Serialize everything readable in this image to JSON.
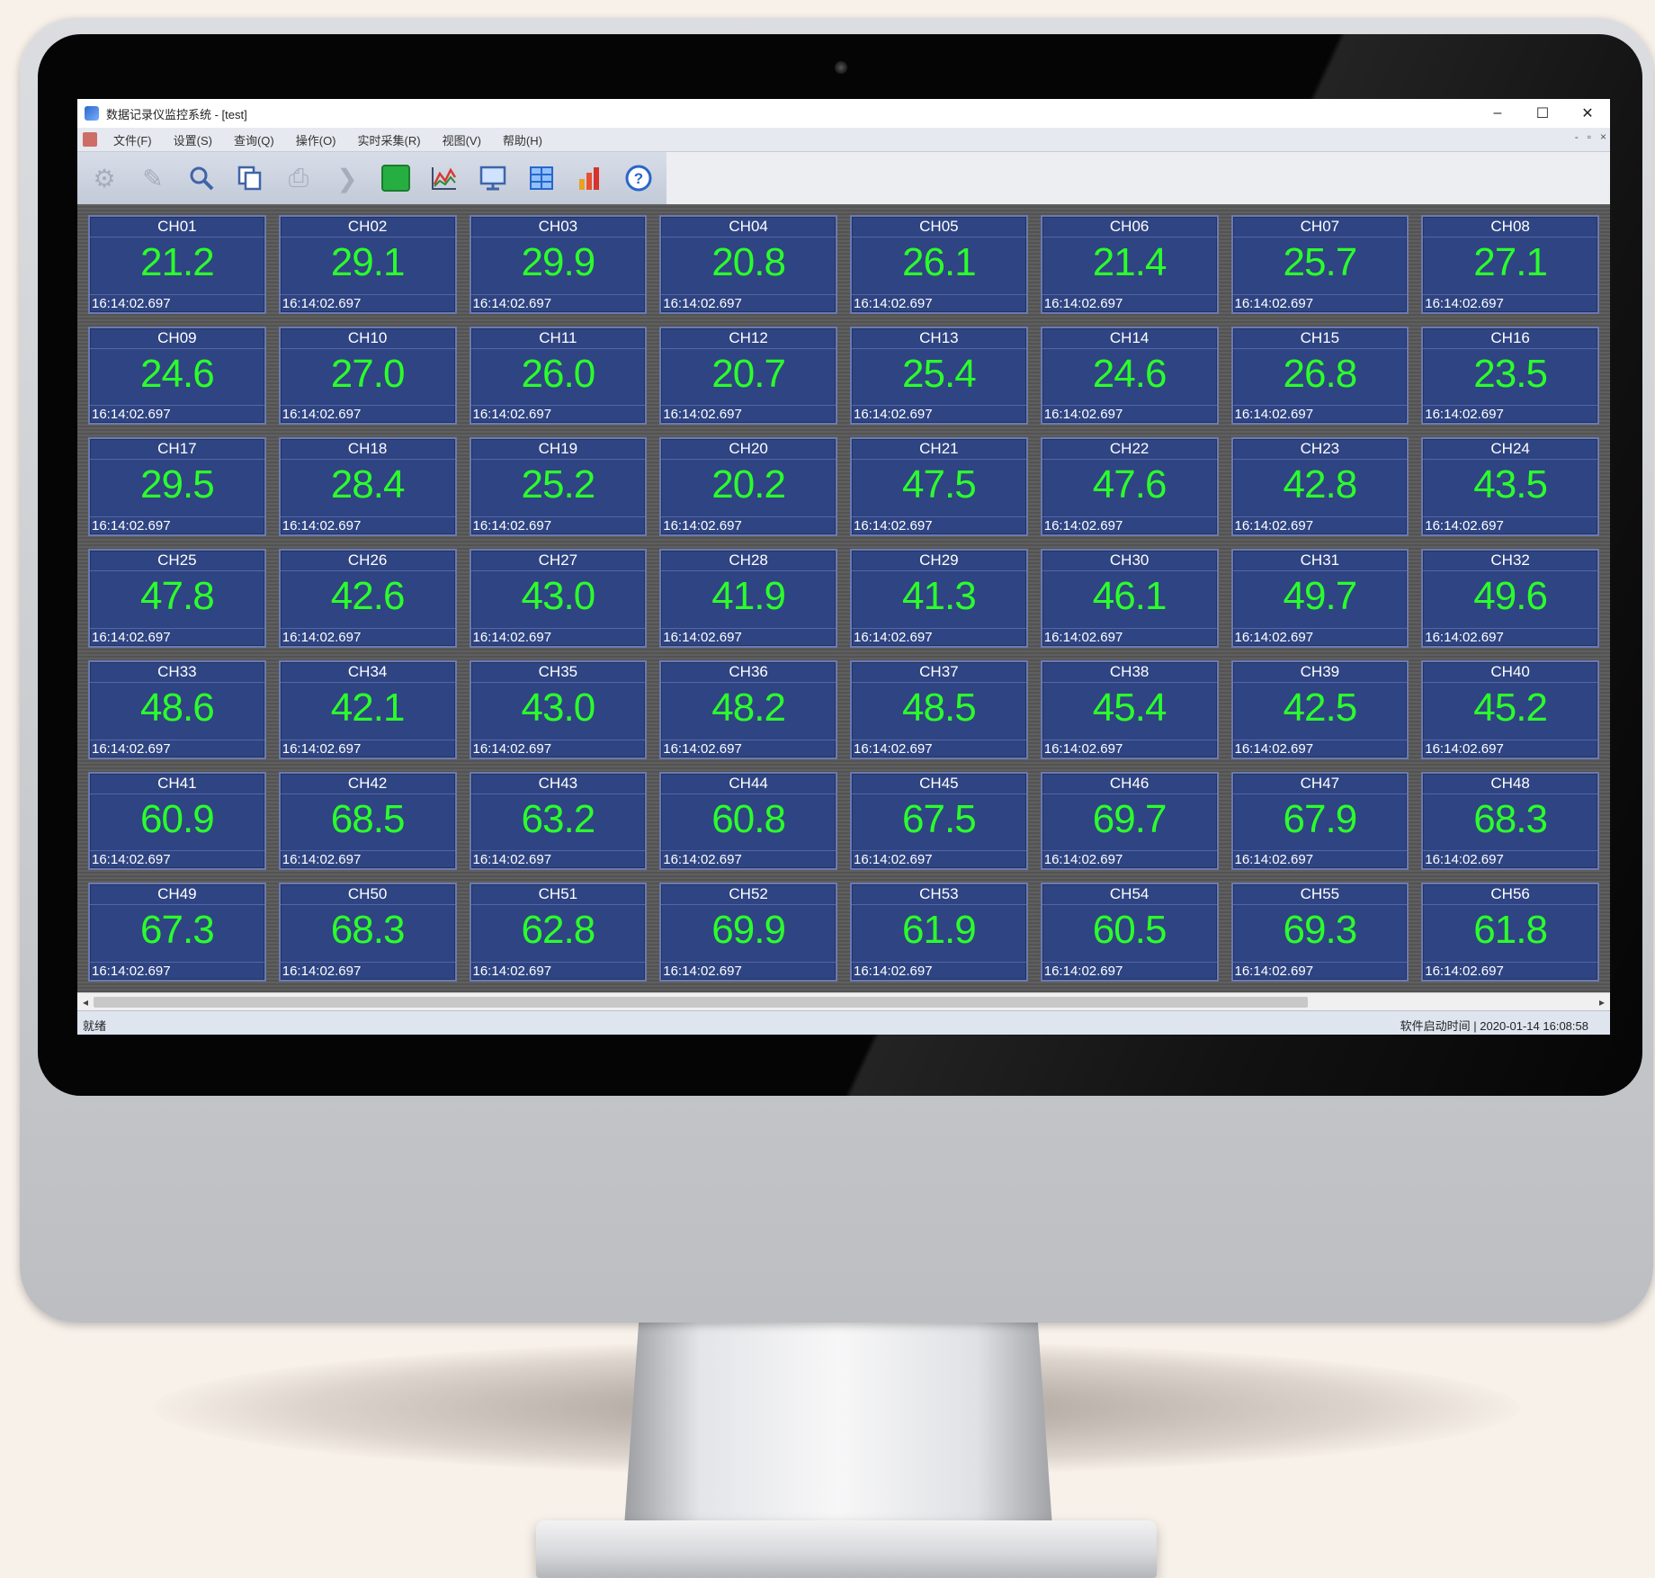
{
  "window": {
    "title": "数据记录仪监控系统 - [test]",
    "minimize": "–",
    "maximize": "☐",
    "close": "✕"
  },
  "menu": [
    "文件(F)",
    "设置(S)",
    "查询(Q)",
    "操作(O)",
    "实时采集(R)",
    "视图(V)",
    "帮助(H)"
  ],
  "mdi_controls": [
    "-",
    "▫",
    "×"
  ],
  "toolbar": [
    "connect-icon",
    "tools-icon",
    "search-icon",
    "copy-icon",
    "print-icon",
    "forward-icon",
    "green-block-icon",
    "curve-chart-icon",
    "monitor-icon",
    "table-icon",
    "bar-chart-icon",
    "help-icon"
  ],
  "channels": [
    {
      "name": "CH01",
      "value": "21.2"
    },
    {
      "name": "CH02",
      "value": "29.1"
    },
    {
      "name": "CH03",
      "value": "29.9"
    },
    {
      "name": "CH04",
      "value": "20.8"
    },
    {
      "name": "CH05",
      "value": "26.1"
    },
    {
      "name": "CH06",
      "value": "21.4"
    },
    {
      "name": "CH07",
      "value": "25.7"
    },
    {
      "name": "CH08",
      "value": "27.1"
    },
    {
      "name": "CH09",
      "value": "24.6"
    },
    {
      "name": "CH10",
      "value": "27.0"
    },
    {
      "name": "CH11",
      "value": "26.0"
    },
    {
      "name": "CH12",
      "value": "20.7"
    },
    {
      "name": "CH13",
      "value": "25.4"
    },
    {
      "name": "CH14",
      "value": "24.6"
    },
    {
      "name": "CH15",
      "value": "26.8"
    },
    {
      "name": "CH16",
      "value": "23.5"
    },
    {
      "name": "CH17",
      "value": "29.5"
    },
    {
      "name": "CH18",
      "value": "28.4"
    },
    {
      "name": "CH19",
      "value": "25.2"
    },
    {
      "name": "CH20",
      "value": "20.2"
    },
    {
      "name": "CH21",
      "value": "47.5"
    },
    {
      "name": "CH22",
      "value": "47.6"
    },
    {
      "name": "CH23",
      "value": "42.8"
    },
    {
      "name": "CH24",
      "value": "43.5"
    },
    {
      "name": "CH25",
      "value": "47.8"
    },
    {
      "name": "CH26",
      "value": "42.6"
    },
    {
      "name": "CH27",
      "value": "43.0"
    },
    {
      "name": "CH28",
      "value": "41.9"
    },
    {
      "name": "CH29",
      "value": "41.3"
    },
    {
      "name": "CH30",
      "value": "46.1"
    },
    {
      "name": "CH31",
      "value": "49.7"
    },
    {
      "name": "CH32",
      "value": "49.6"
    },
    {
      "name": "CH33",
      "value": "48.6"
    },
    {
      "name": "CH34",
      "value": "42.1"
    },
    {
      "name": "CH35",
      "value": "43.0"
    },
    {
      "name": "CH36",
      "value": "48.2"
    },
    {
      "name": "CH37",
      "value": "48.5"
    },
    {
      "name": "CH38",
      "value": "45.4"
    },
    {
      "name": "CH39",
      "value": "42.5"
    },
    {
      "name": "CH40",
      "value": "45.2"
    },
    {
      "name": "CH41",
      "value": "60.9"
    },
    {
      "name": "CH42",
      "value": "68.5"
    },
    {
      "name": "CH43",
      "value": "63.2"
    },
    {
      "name": "CH44",
      "value": "60.8"
    },
    {
      "name": "CH45",
      "value": "67.5"
    },
    {
      "name": "CH46",
      "value": "69.7"
    },
    {
      "name": "CH47",
      "value": "67.9"
    },
    {
      "name": "CH48",
      "value": "68.3"
    },
    {
      "name": "CH49",
      "value": "67.3"
    },
    {
      "name": "CH50",
      "value": "68.3"
    },
    {
      "name": "CH51",
      "value": "62.8"
    },
    {
      "name": "CH52",
      "value": "69.9"
    },
    {
      "name": "CH53",
      "value": "61.9"
    },
    {
      "name": "CH54",
      "value": "60.5"
    },
    {
      "name": "CH55",
      "value": "69.3"
    },
    {
      "name": "CH56",
      "value": "61.8"
    }
  ],
  "timestamp": "16:14:02.697",
  "status": {
    "left": "就绪",
    "right": "软件启动时间 | 2020-01-14 16:08:58"
  },
  "colors": {
    "cell_bg": "#2f4482",
    "value_text": "#2bff2b",
    "grid_bg": "#5a5a5a"
  }
}
